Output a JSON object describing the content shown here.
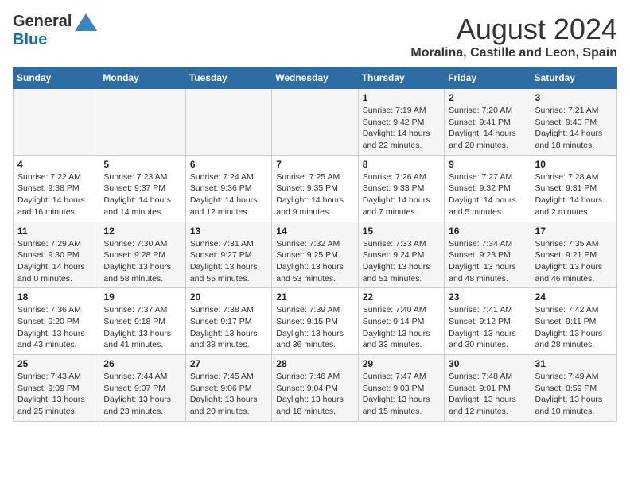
{
  "header": {
    "logo_general": "General",
    "logo_blue": "Blue",
    "month_title": "August 2024",
    "location": "Moralina, Castille and Leon, Spain"
  },
  "weekdays": [
    "Sunday",
    "Monday",
    "Tuesday",
    "Wednesday",
    "Thursday",
    "Friday",
    "Saturday"
  ],
  "weeks": [
    [
      null,
      null,
      null,
      null,
      {
        "day": 1,
        "sunrise": "7:19 AM",
        "sunset": "9:42 PM",
        "daylight": "14 hours and 22 minutes."
      },
      {
        "day": 2,
        "sunrise": "7:20 AM",
        "sunset": "9:41 PM",
        "daylight": "14 hours and 20 minutes."
      },
      {
        "day": 3,
        "sunrise": "7:21 AM",
        "sunset": "9:40 PM",
        "daylight": "14 hours and 18 minutes."
      }
    ],
    [
      {
        "day": 4,
        "sunrise": "7:22 AM",
        "sunset": "9:38 PM",
        "daylight": "14 hours and 16 minutes."
      },
      {
        "day": 5,
        "sunrise": "7:23 AM",
        "sunset": "9:37 PM",
        "daylight": "14 hours and 14 minutes."
      },
      {
        "day": 6,
        "sunrise": "7:24 AM",
        "sunset": "9:36 PM",
        "daylight": "14 hours and 12 minutes."
      },
      {
        "day": 7,
        "sunrise": "7:25 AM",
        "sunset": "9:35 PM",
        "daylight": "14 hours and 9 minutes."
      },
      {
        "day": 8,
        "sunrise": "7:26 AM",
        "sunset": "9:33 PM",
        "daylight": "14 hours and 7 minutes."
      },
      {
        "day": 9,
        "sunrise": "7:27 AM",
        "sunset": "9:32 PM",
        "daylight": "14 hours and 5 minutes."
      },
      {
        "day": 10,
        "sunrise": "7:28 AM",
        "sunset": "9:31 PM",
        "daylight": "14 hours and 2 minutes."
      }
    ],
    [
      {
        "day": 11,
        "sunrise": "7:29 AM",
        "sunset": "9:30 PM",
        "daylight": "14 hours and 0 minutes."
      },
      {
        "day": 12,
        "sunrise": "7:30 AM",
        "sunset": "9:28 PM",
        "daylight": "13 hours and 58 minutes."
      },
      {
        "day": 13,
        "sunrise": "7:31 AM",
        "sunset": "9:27 PM",
        "daylight": "13 hours and 55 minutes."
      },
      {
        "day": 14,
        "sunrise": "7:32 AM",
        "sunset": "9:25 PM",
        "daylight": "13 hours and 53 minutes."
      },
      {
        "day": 15,
        "sunrise": "7:33 AM",
        "sunset": "9:24 PM",
        "daylight": "13 hours and 51 minutes."
      },
      {
        "day": 16,
        "sunrise": "7:34 AM",
        "sunset": "9:23 PM",
        "daylight": "13 hours and 48 minutes."
      },
      {
        "day": 17,
        "sunrise": "7:35 AM",
        "sunset": "9:21 PM",
        "daylight": "13 hours and 46 minutes."
      }
    ],
    [
      {
        "day": 18,
        "sunrise": "7:36 AM",
        "sunset": "9:20 PM",
        "daylight": "13 hours and 43 minutes."
      },
      {
        "day": 19,
        "sunrise": "7:37 AM",
        "sunset": "9:18 PM",
        "daylight": "13 hours and 41 minutes."
      },
      {
        "day": 20,
        "sunrise": "7:38 AM",
        "sunset": "9:17 PM",
        "daylight": "13 hours and 38 minutes."
      },
      {
        "day": 21,
        "sunrise": "7:39 AM",
        "sunset": "9:15 PM",
        "daylight": "13 hours and 36 minutes."
      },
      {
        "day": 22,
        "sunrise": "7:40 AM",
        "sunset": "9:14 PM",
        "daylight": "13 hours and 33 minutes."
      },
      {
        "day": 23,
        "sunrise": "7:41 AM",
        "sunset": "9:12 PM",
        "daylight": "13 hours and 30 minutes."
      },
      {
        "day": 24,
        "sunrise": "7:42 AM",
        "sunset": "9:11 PM",
        "daylight": "13 hours and 28 minutes."
      }
    ],
    [
      {
        "day": 25,
        "sunrise": "7:43 AM",
        "sunset": "9:09 PM",
        "daylight": "13 hours and 25 minutes."
      },
      {
        "day": 26,
        "sunrise": "7:44 AM",
        "sunset": "9:07 PM",
        "daylight": "13 hours and 23 minutes."
      },
      {
        "day": 27,
        "sunrise": "7:45 AM",
        "sunset": "9:06 PM",
        "daylight": "13 hours and 20 minutes."
      },
      {
        "day": 28,
        "sunrise": "7:46 AM",
        "sunset": "9:04 PM",
        "daylight": "13 hours and 18 minutes."
      },
      {
        "day": 29,
        "sunrise": "7:47 AM",
        "sunset": "9:03 PM",
        "daylight": "13 hours and 15 minutes."
      },
      {
        "day": 30,
        "sunrise": "7:48 AM",
        "sunset": "9:01 PM",
        "daylight": "13 hours and 12 minutes."
      },
      {
        "day": 31,
        "sunrise": "7:49 AM",
        "sunset": "8:59 PM",
        "daylight": "13 hours and 10 minutes."
      }
    ]
  ],
  "labels": {
    "sunrise": "Sunrise:",
    "sunset": "Sunset:",
    "daylight": "Daylight:"
  }
}
